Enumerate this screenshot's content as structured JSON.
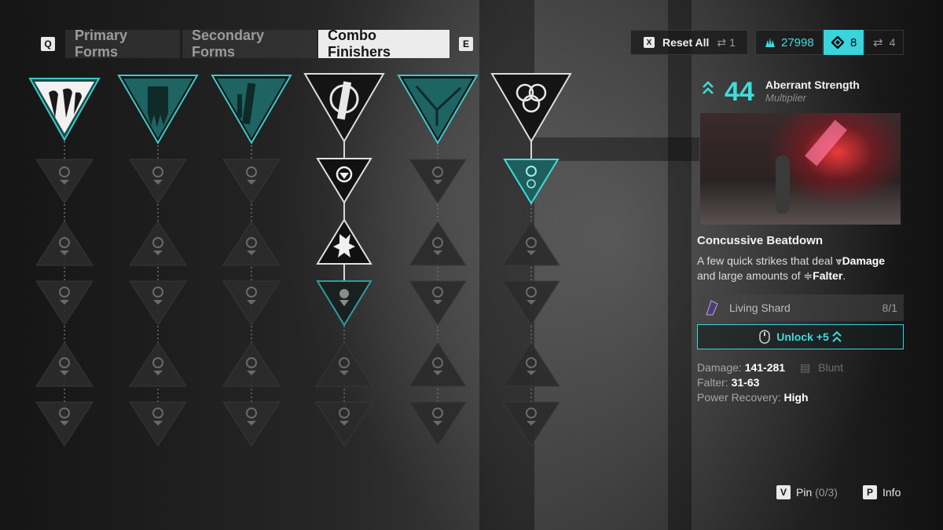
{
  "tabs": {
    "prev_key": "Q",
    "next_key": "E",
    "items": [
      {
        "label": "Primary Forms",
        "active": false
      },
      {
        "label": "Secondary Forms",
        "active": false
      },
      {
        "label": "Combo Finishers",
        "active": true
      }
    ]
  },
  "top_right": {
    "reset_key": "X",
    "reset_label": "Reset All",
    "reset_count": "1",
    "currency_value": "27998",
    "shard_value": "8",
    "swap_value": "4"
  },
  "tree": {
    "columns": [
      {
        "icon": "claw-mark-icon",
        "selected": true,
        "header_style": "white"
      },
      {
        "icon": "banner-icon",
        "selected": false,
        "header_style": "teal"
      },
      {
        "icon": "blade-icon",
        "selected": false,
        "header_style": "teal"
      },
      {
        "icon": "sword-crest-icon",
        "selected": false,
        "header_style": "dark-outline"
      },
      {
        "icon": "thorn-branch-icon",
        "selected": false,
        "header_style": "teal"
      },
      {
        "icon": "rings-crest-icon",
        "selected": false,
        "header_style": "dark-outline"
      }
    ]
  },
  "detail": {
    "attribute_value": "44",
    "attribute_name": "Aberrant Strength",
    "attribute_sub": "Multiplier",
    "skill_name": "Concussive Beatdown",
    "description_part1": "A few quick strikes that deal",
    "damage_word": "Damage",
    "description_part2": "and large amounts of",
    "falter_word": "Falter",
    "description_end": ".",
    "cost_item_name": "Living Shard",
    "cost_amount": "8",
    "cost_separator": "/",
    "cost_required": "1",
    "unlock_label": "Unlock +5",
    "stats": {
      "damage_label": "Damage:",
      "damage_value": "141-281",
      "damage_type": "Blunt",
      "falter_label": "Falter:",
      "falter_value": "31-63",
      "power_label": "Power Recovery:",
      "power_value": "High"
    }
  },
  "footer": {
    "pin_key": "V",
    "pin_label": "Pin",
    "pin_count": "(0/3)",
    "info_key": "P",
    "info_label": "Info"
  },
  "colors": {
    "accent": "#39d4dc",
    "teal_dark": "#1f5554",
    "node_dim": "#2b2b2b"
  }
}
